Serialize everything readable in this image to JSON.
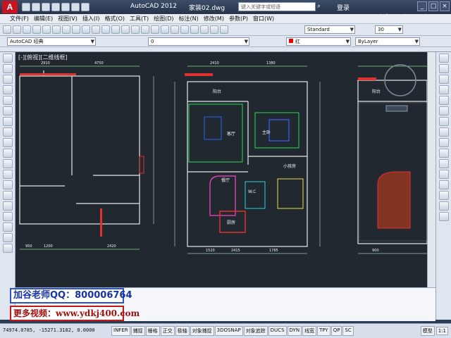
{
  "app": {
    "logo": "A",
    "title": "AutoCAD 2012",
    "file": "家装02.dwg"
  },
  "search": {
    "placeholder": "键入关键字或短语"
  },
  "login_label": "登录",
  "watermark": "搜狐视频",
  "menu": [
    "文件(F)",
    "编辑(E)",
    "视图(V)",
    "插入(I)",
    "格式(O)",
    "工具(T)",
    "绘图(D)",
    "标注(N)",
    "修改(M)",
    "参数(P)",
    "窗口(W)"
  ],
  "toolbar2": {
    "text_style": "Standard",
    "dim_size": "30"
  },
  "toolbar3": {
    "workspace": "AutoCAD 经典",
    "layer": "0",
    "color": "红",
    "linetype": "ByLayer"
  },
  "viewport_label": "[-][俯视][二维线框]",
  "plan": {
    "rooms": [
      "阳台",
      "客厅",
      "主卧",
      "小孩房",
      "餐厅",
      "W.C",
      "厨房",
      "阳台"
    ],
    "dims": [
      "2910",
      "4750",
      "2410",
      "1380",
      "1200",
      "2420",
      "1520",
      "950",
      "2415",
      "1785",
      "900"
    ]
  },
  "overlay": {
    "qq": "加谷老师QQ：800006764",
    "site": "更多视频：www.ydkj400.com"
  },
  "statusbar": {
    "coords": "74974.0785, -15271.3182, 0.0000",
    "buttons": [
      "INFER",
      "捕捉",
      "栅格",
      "正交",
      "极轴",
      "对象捕捉",
      "3DOSNAP",
      "对象追踪",
      "DUCS",
      "DYN",
      "线宽",
      "TPY",
      "QP",
      "SC"
    ],
    "model_label": "模型",
    "scale": "1:1"
  }
}
